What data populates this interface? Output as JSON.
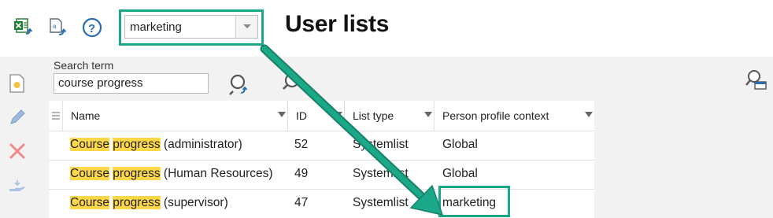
{
  "toolbar": {
    "excel_icon": "excel-export-icon",
    "export_icon": "document-export-icon",
    "help_icon": "help-circle-icon",
    "context_select_value": "marketing",
    "title": "User lists"
  },
  "sidebar": {
    "icons": [
      "new-list-icon",
      "edit-pencil-icon",
      "delete-x-icon",
      "hand-transfer-icon"
    ]
  },
  "search": {
    "label": "Search term",
    "value": "course progress",
    "search_icon": "person-search-icon",
    "magnifier_icon": "magnifier-icon",
    "side_panel_icon": "person-panel-icon"
  },
  "table": {
    "columns": [
      "Name",
      "ID",
      "List type",
      "Person profile context"
    ],
    "rows": [
      {
        "name_hl1": "Course",
        "name_hl2": "progress",
        "name_rest": "(administrator)",
        "id": "52",
        "type": "Systemlist",
        "context": "Global"
      },
      {
        "name_hl1": "Course",
        "name_hl2": "progress",
        "name_rest": "(Human Resources)",
        "id": "49",
        "type": "Systemlist",
        "context": "Global"
      },
      {
        "name_hl1": "Course",
        "name_hl2": "progress",
        "name_rest": "(supervisor)",
        "id": "47",
        "type": "Systemlist",
        "context": "marketing"
      }
    ]
  },
  "colors": {
    "annotation": "#1aa889",
    "search_highlight": "#ffd84a",
    "panel_bg": "#f2f2f2"
  }
}
